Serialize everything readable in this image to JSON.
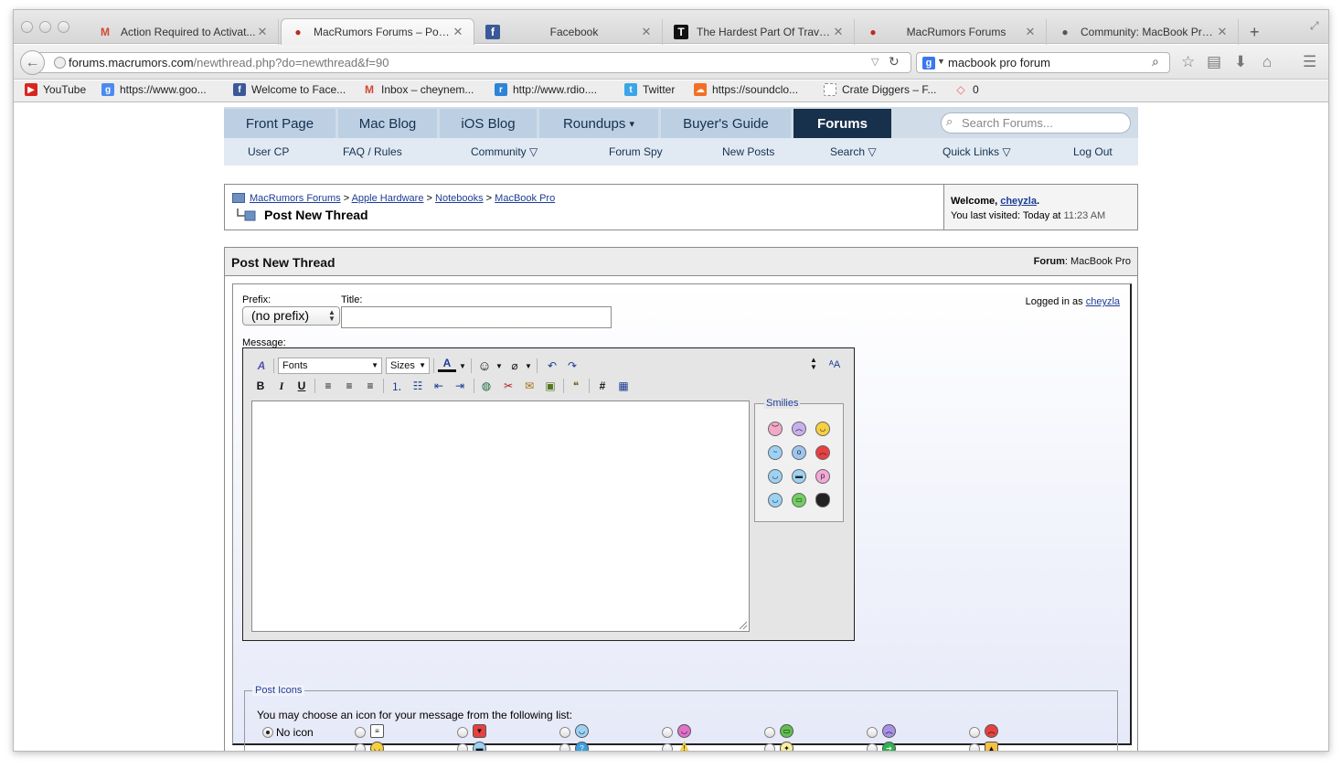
{
  "browser": {
    "tabs": [
      {
        "title": "Action Required to Activat...",
        "favicon": "gmail-icon"
      },
      {
        "title": "MacRumors Forums – Pos...",
        "favicon": "macrumors-icon"
      },
      {
        "title": "Facebook",
        "favicon": "facebook-icon"
      },
      {
        "title": "The Hardest Part Of Travel...",
        "favicon": "t-icon"
      },
      {
        "title": "MacRumors Forums",
        "favicon": "macrumors-icon"
      },
      {
        "title": "Community: MacBook Pro ...",
        "favicon": "apple-icon"
      }
    ],
    "url_host": "forums.macrumors.com",
    "url_path": "/newthread.php?do=newthread&f=90",
    "search_value": "macbook pro forum",
    "bookmarks": [
      {
        "label": "YouTube",
        "icon": "youtube-icon",
        "color": "#d8261f"
      },
      {
        "label": "https://www.goo...",
        "icon": "google-icon",
        "color": "#4b8af0"
      },
      {
        "label": "Welcome to Face...",
        "icon": "facebook-icon",
        "color": "#3b5998"
      },
      {
        "label": "Inbox – cheynem...",
        "icon": "gmail-icon",
        "color": "#d14836"
      },
      {
        "label": "http://www.rdio....",
        "icon": "rdio-icon",
        "color": "#2e84d6"
      },
      {
        "label": "Twitter",
        "icon": "twitter-icon",
        "color": "#3aa5e8"
      },
      {
        "label": "https://soundclo...",
        "icon": "soundcloud-icon",
        "color": "#f26f23"
      },
      {
        "label": "Crate Diggers – F...",
        "icon": "page-icon",
        "color": "#bbbbbb"
      },
      {
        "label": "0",
        "icon": "airbnb-icon",
        "color": "#ff5a5f"
      }
    ]
  },
  "site": {
    "nav": [
      "Front Page",
      "Mac Blog",
      "iOS Blog",
      "Roundups",
      "Buyer's Guide",
      "Forums"
    ],
    "roundups_caret": "▾",
    "search_placeholder": "Search Forums...",
    "subnav": [
      "User CP",
      "FAQ / Rules",
      "Community",
      "Forum Spy",
      "New Posts",
      "Search",
      "Quick Links",
      "Log Out"
    ]
  },
  "breadcrumb": {
    "items": [
      "MacRumors Forums",
      "Apple Hardware",
      "Notebooks",
      "MacBook Pro"
    ],
    "separator": ">",
    "current": "Post New Thread",
    "welcome_label": "Welcome,",
    "username": "cheyzla",
    "welcome_end": ".",
    "last_visited_label": "You last visited: Today at",
    "last_visited_time": "11:23 AM"
  },
  "post": {
    "header_title": "Post New Thread",
    "forum_label": "Forum",
    "forum_name": ": MacBook Pro",
    "prefix_label": "Prefix:",
    "prefix_value": "(no prefix)",
    "title_label": "Title:",
    "title_value": "",
    "message_label": "Message:",
    "logged_in_label": "Logged in as",
    "logged_in_user": "cheyzla",
    "toolbar": {
      "fonts": "Fonts",
      "sizes": "Sizes",
      "bold": "B",
      "italic": "I",
      "underline": "U",
      "hash": "#"
    },
    "smilies_legend": "Smilies",
    "post_icons_legend": "Post Icons",
    "post_icons_desc": "You may choose an icon for your message from the following list:",
    "no_icon_label": "No icon"
  },
  "colors": {
    "nav_active": "#17304c",
    "nav_tab": "#bdd0e3",
    "link": "#1c3d96"
  }
}
